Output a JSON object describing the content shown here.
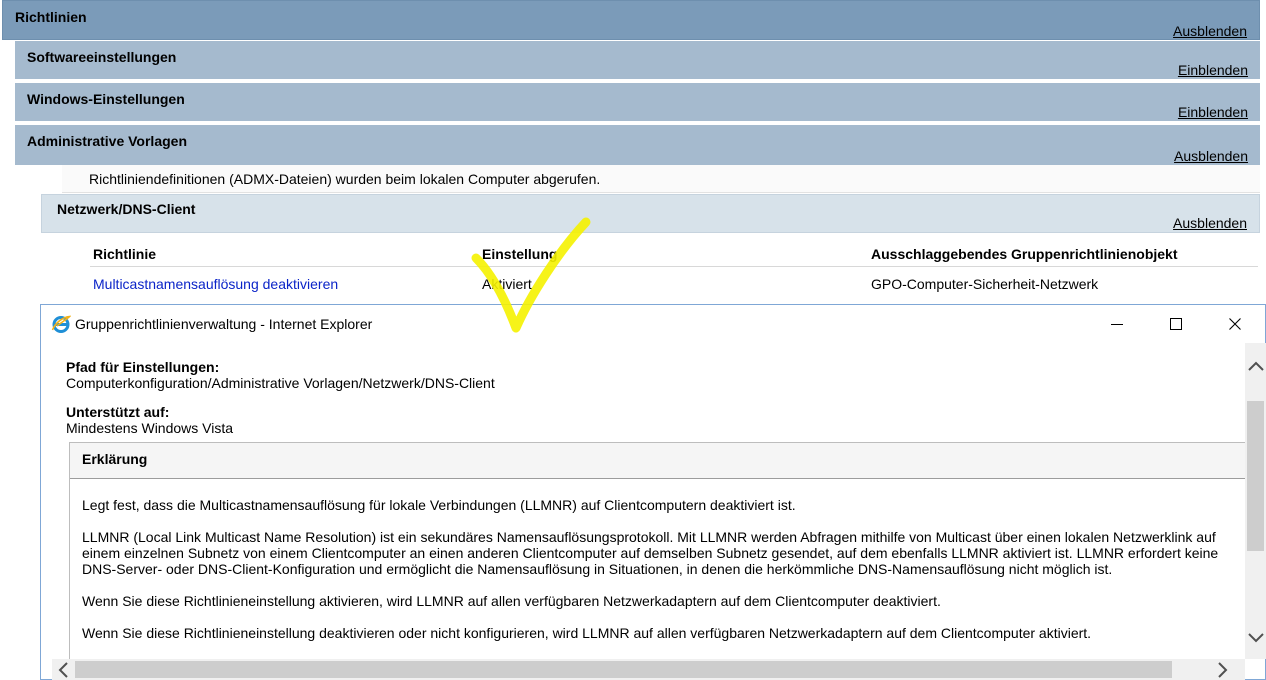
{
  "report": {
    "sections": {
      "richtlinien": {
        "title": "Richtlinien",
        "toggle": "Ausblenden"
      },
      "software": {
        "title": "Softwareeinstellungen",
        "toggle": "Einblenden"
      },
      "windows": {
        "title": "Windows-Einstellungen",
        "toggle": "Einblenden"
      },
      "admin": {
        "title": "Administrative Vorlagen",
        "toggle": "Ausblenden"
      },
      "dns": {
        "title": "Netzwerk/DNS-Client",
        "toggle": "Ausblenden"
      }
    },
    "admx_info": "Richtliniendefinitionen (ADMX-Dateien) wurden beim lokalen Computer abgerufen.",
    "table": {
      "headers": [
        "Richtlinie",
        "Einstellung",
        "Ausschlaggebendes Gruppenrichtlinienobjekt"
      ],
      "rows": [
        {
          "policy": "Multicastnamensauflösung deaktivieren",
          "setting": "Aktiviert",
          "gpo": "GPO-Computer-Sicherheit-Netzwerk"
        }
      ]
    }
  },
  "annotation": {
    "type": "checkmark",
    "color": "#f5f200"
  },
  "popup": {
    "title": "Gruppenrichtlinienverwaltung - Internet Explorer",
    "icon": "internet-explorer-icon",
    "controls": {
      "minimize": "minimize-icon",
      "maximize": "maximize-icon",
      "close": "close-icon"
    },
    "path_label": "Pfad für Einstellungen:",
    "path_value": "Computerkonfiguration/Administrative Vorlagen/Netzwerk/DNS-Client",
    "supported_label": "Unterstützt auf:",
    "supported_value": "Mindestens Windows Vista",
    "explanation_label": "Erklärung",
    "paragraphs": [
      "Legt fest, dass die Multicastnamensauflösung für lokale Verbindungen (LLMNR) auf Clientcomputern deaktiviert ist.",
      "LLMNR (Local Link Multicast Name Resolution) ist ein sekundäres Namensauflösungsprotokoll. Mit LLMNR werden Abfragen mithilfe von Multicast über einen lokalen Netzwerklink auf einem einzelnen Subnetz von einem Clientcomputer an einen anderen Clientcomputer auf demselben Subnetz gesendet, auf dem ebenfalls LLMNR aktiviert ist. LLMNR erfordert keine DNS-Server- oder DNS-Client-Konfiguration und ermöglicht die Namensauflösung in Situationen, in denen die herkömmliche DNS-Namensauflösung nicht möglich ist.",
      "Wenn Sie diese Richtlinieneinstellung aktivieren, wird LLMNR auf allen verfügbaren Netzwerkadaptern auf dem Clientcomputer deaktiviert.",
      "Wenn Sie diese Richtlinieneinstellung deaktivieren oder nicht konfigurieren, wird LLMNR auf allen verfügbaren Netzwerkadaptern auf dem Clientcomputer aktiviert."
    ]
  }
}
